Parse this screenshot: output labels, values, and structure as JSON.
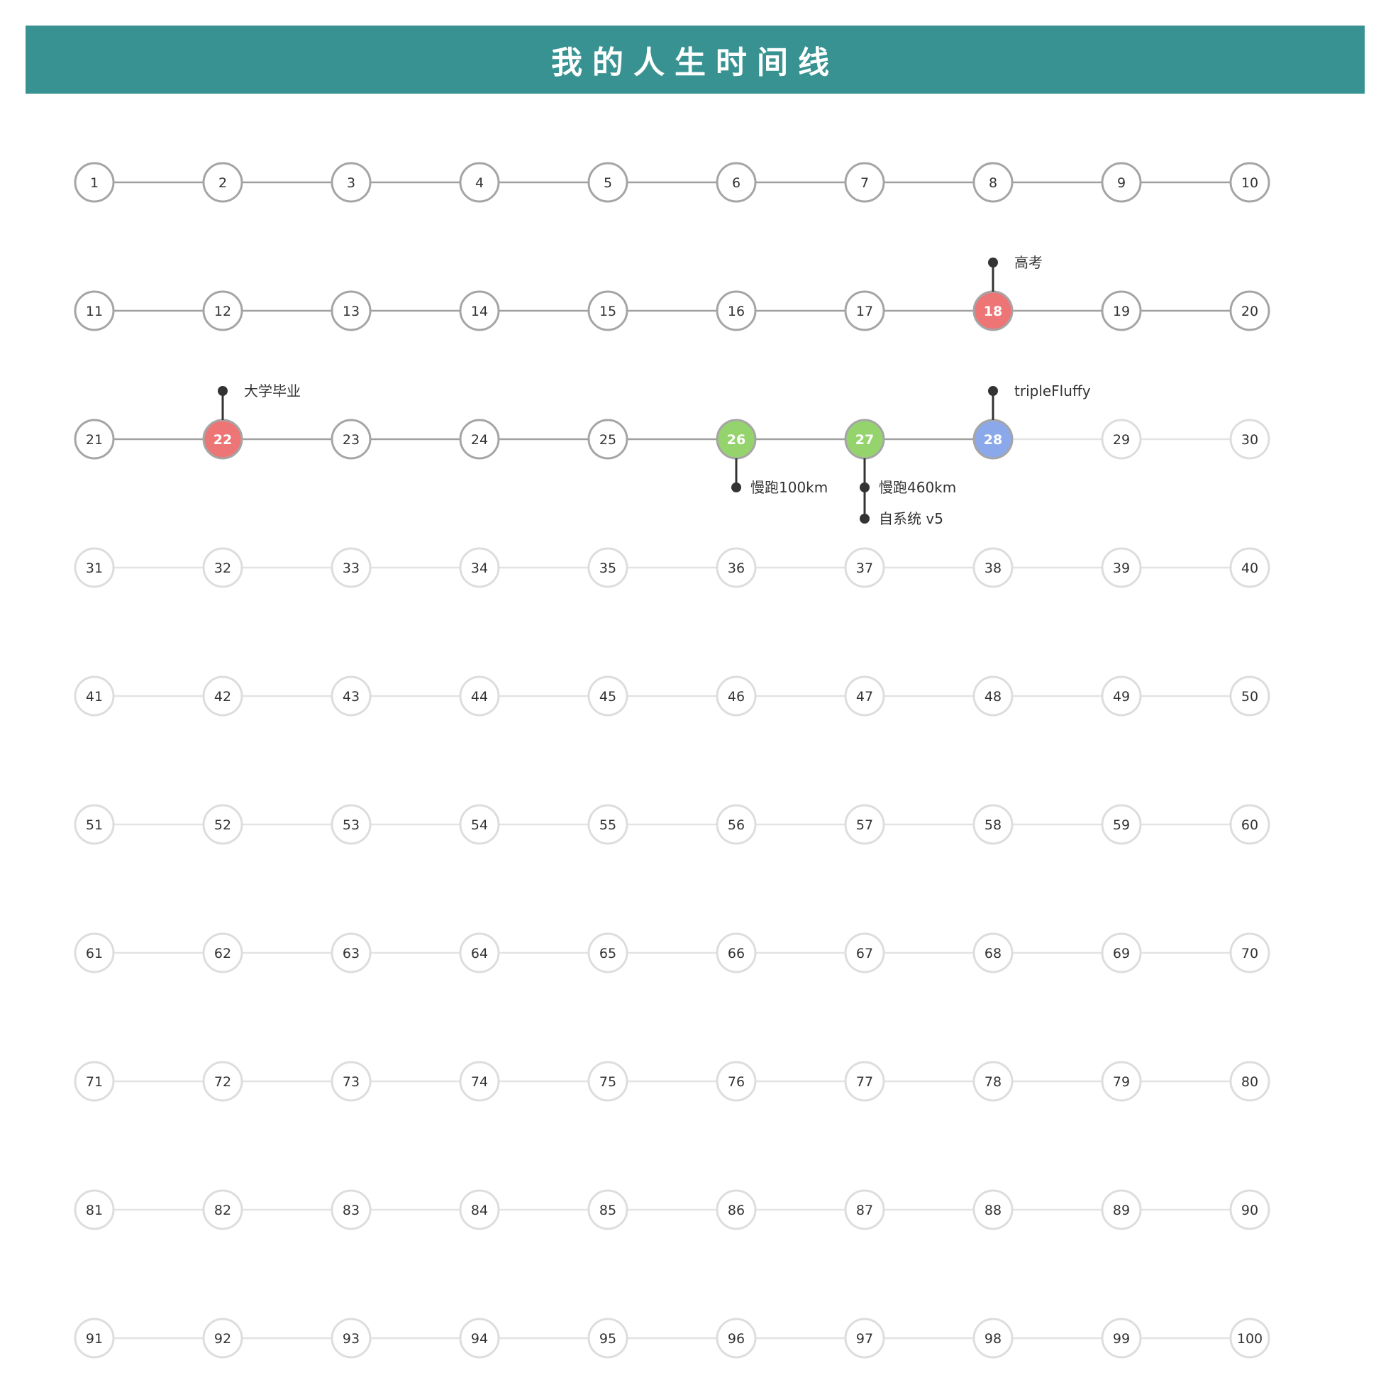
{
  "title": "我的人生时间线",
  "timeline": {
    "start": 1,
    "end": 100,
    "per_row": 10,
    "current_age": 28,
    "colors": {
      "past_stroke": "#a5a5a5",
      "past_line": "#a0a0a0",
      "future_stroke": "#dddddd",
      "future_line": "#e3e3e3",
      "text_dark": "#333333",
      "text_future": "#333333",
      "highlight_red": "#ee7575",
      "highlight_green": "#95d46c",
      "highlight_blue": "#8ba9ea",
      "marker": "#333333",
      "title_bg": "#389292"
    },
    "highlights": [
      {
        "age": 18,
        "color": "red"
      },
      {
        "age": 22,
        "color": "red"
      },
      {
        "age": 26,
        "color": "green"
      },
      {
        "age": 27,
        "color": "green"
      },
      {
        "age": 28,
        "color": "blue"
      }
    ],
    "events": [
      {
        "age": 18,
        "position": "above",
        "labels": [
          "高考"
        ]
      },
      {
        "age": 22,
        "position": "above",
        "labels": [
          "大学毕业"
        ]
      },
      {
        "age": 26,
        "position": "below",
        "labels": [
          "慢跑100km"
        ]
      },
      {
        "age": 27,
        "position": "below",
        "labels": [
          "慢跑460km",
          "自系统 v5"
        ]
      },
      {
        "age": 28,
        "position": "above",
        "labels": [
          "tripleFluffy"
        ]
      }
    ]
  }
}
